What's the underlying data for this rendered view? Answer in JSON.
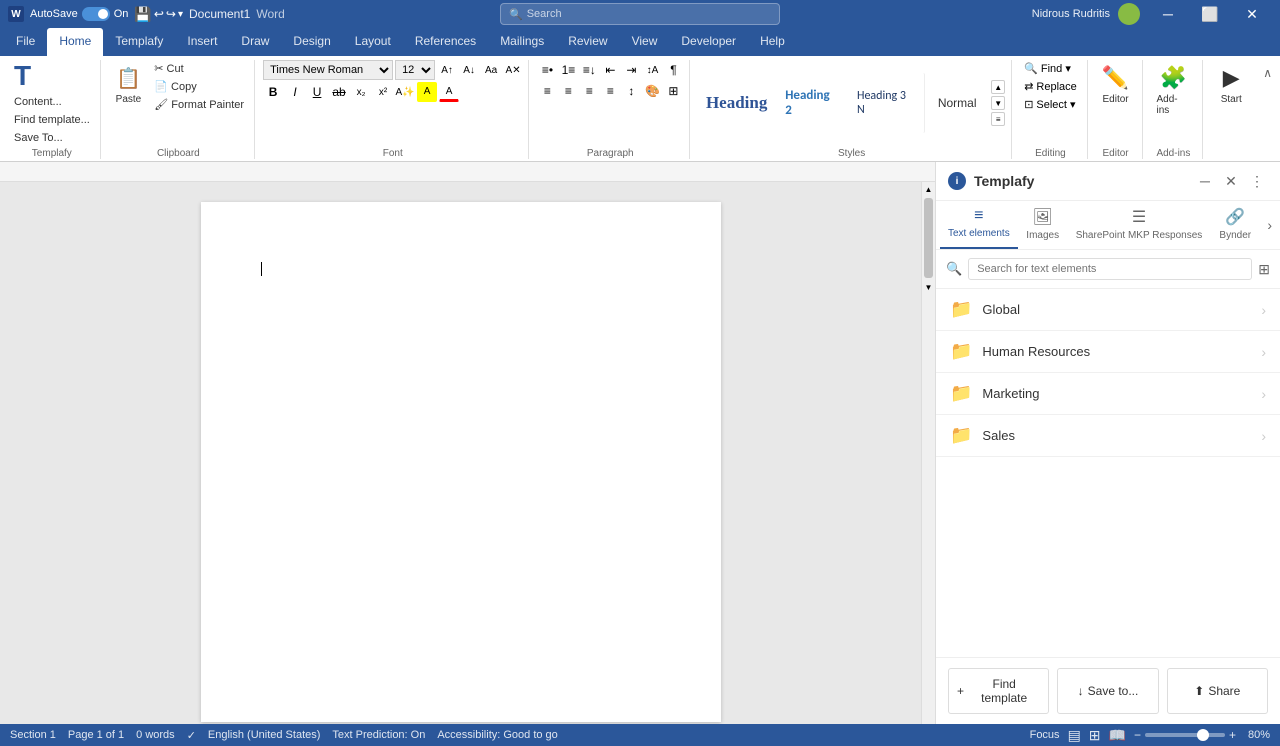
{
  "titlebar": {
    "app_icon": "W",
    "autosave_label": "AutoSave",
    "toggle_state": "on",
    "doc_title": "Document1",
    "app_name": "Word",
    "search_placeholder": "Search",
    "user_name": "Nidrous Rudritis",
    "win_minimize": "─",
    "win_restore": "□",
    "win_close": "✕"
  },
  "ribbon": {
    "tabs": [
      "File",
      "Home",
      "Templafy",
      "Insert",
      "Draw",
      "Design",
      "Layout",
      "References",
      "Mailings",
      "Review",
      "View",
      "Developer",
      "Help"
    ],
    "active_tab": "Home",
    "groups": {
      "templafy": {
        "label": "Templafy",
        "buttons": [
          "Content...",
          "Find template...",
          "Save To..."
        ]
      },
      "clipboard": {
        "label": "Clipboard",
        "paste_label": "Paste"
      },
      "font": {
        "label": "Font",
        "font_name": "Times New Roman (  ",
        "font_size": "12",
        "bold": "B",
        "italic": "I",
        "underline": "U",
        "strikethrough": "ab",
        "subscript": "x₂",
        "superscript": "x²"
      },
      "paragraph": {
        "label": "Paragraph"
      },
      "styles": {
        "label": "Styles",
        "items": [
          {
            "label": "Heading",
            "class": "heading1"
          },
          {
            "label": "Heading 2",
            "class": "heading2"
          },
          {
            "label": "Heading 3 N",
            "class": "heading3"
          },
          {
            "label": "Normal",
            "class": "normal"
          }
        ]
      },
      "editing": {
        "label": "Editing",
        "find": "Find",
        "replace": "Replace",
        "select": "Select"
      },
      "editor_group": {
        "label": "Editor"
      },
      "addins": {
        "label": "Add-ins"
      }
    }
  },
  "templafy_panel": {
    "title": "Templafy",
    "info_label": "i",
    "tabs": [
      {
        "id": "text-elements",
        "label": "Text elements",
        "icon": "≡",
        "active": true
      },
      {
        "id": "images",
        "label": "Images",
        "icon": "🖼"
      },
      {
        "id": "sharepoint",
        "label": "SharePoint MKP Responses",
        "icon": "☰"
      },
      {
        "id": "bynder",
        "label": "Bynder",
        "icon": "🔗"
      }
    ],
    "search_placeholder": "Search for text elements",
    "folders": [
      {
        "id": "global",
        "name": "Global"
      },
      {
        "id": "human-resources",
        "name": "Human Resources"
      },
      {
        "id": "marketing",
        "name": "Marketing"
      },
      {
        "id": "sales",
        "name": "Sales"
      }
    ],
    "footer": {
      "find_template": "+ Find template",
      "save_to": "↓ Save to...",
      "share": "⬆ Share"
    }
  },
  "statusbar": {
    "section": "Section 1",
    "page": "Page 1 of 1",
    "words": "0 words",
    "lang": "English (United States)",
    "text_predictions": "Text Prediction: On",
    "accessibility": "Accessibility: Good to go",
    "focus": "Focus",
    "zoom": "80%"
  }
}
